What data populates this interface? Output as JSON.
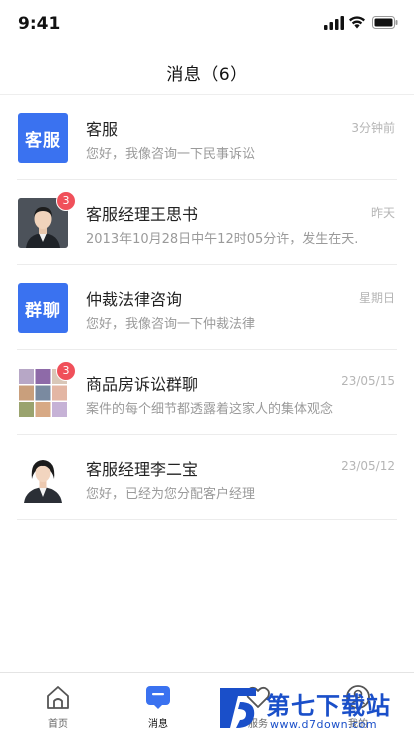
{
  "status_bar": {
    "time": "9:41"
  },
  "header": {
    "title": "消息（6）"
  },
  "conversations": [
    {
      "avatar_text": "客服",
      "avatar_type": "text",
      "badge": "",
      "name": "客服",
      "time": "3分钟前",
      "preview": "您好，我像咨询一下民事诉讼"
    },
    {
      "avatar_text": "",
      "avatar_type": "photo-man",
      "badge": "3",
      "name": "客服经理王思书",
      "time": "昨天",
      "preview": "2013年10月28日中午12时05分许，发生在天..."
    },
    {
      "avatar_text": "群聊",
      "avatar_type": "text",
      "badge": "",
      "name": "仲裁法律咨询",
      "time": "星期日",
      "preview": "您好，我像咨询一下仲裁法律"
    },
    {
      "avatar_text": "",
      "avatar_type": "group-grid",
      "badge": "3",
      "name": "商品房诉讼群聊",
      "time": "23/05/15",
      "preview": "案件的每个细节都透露着这家人的集体观念"
    },
    {
      "avatar_text": "",
      "avatar_type": "photo-woman",
      "badge": "",
      "name": "客服经理李二宝",
      "time": "23/05/12",
      "preview": "您好，已经为您分配客户经理"
    }
  ],
  "tabs": [
    {
      "label": "首页",
      "icon": "home-icon",
      "active": false
    },
    {
      "label": "消息",
      "icon": "message-icon",
      "active": true
    },
    {
      "label": "服务",
      "icon": "heart-icon",
      "active": false
    },
    {
      "label": "我的",
      "icon": "user-icon",
      "active": false
    }
  ],
  "watermark": {
    "text": "第七下载站",
    "sub": "www.d7down.com"
  },
  "colors": {
    "accent": "#3a72f0",
    "badge": "#f0505a",
    "watermark": "#1a4fc9"
  }
}
